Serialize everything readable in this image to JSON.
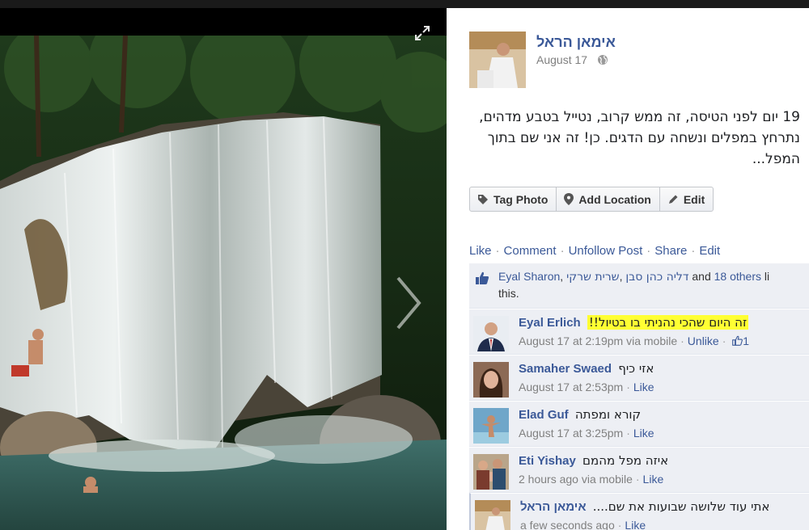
{
  "post": {
    "author": "אימאן הראל",
    "date": "August 17",
    "caption": "19 יום לפני הטיסה, זה ממש קרוב, נטייל בטבע מדהים, נתרחץ במפלים ונשחה עם הדגים. כן! זה אני שם בתוך המפל...",
    "actions": {
      "tag_photo": "Tag Photo",
      "add_location": "Add Location",
      "edit": "Edit"
    },
    "links": {
      "like": "Like",
      "comment": "Comment",
      "unfollow": "Unfollow Post",
      "share": "Share",
      "edit": "Edit"
    }
  },
  "likes": {
    "name1": "Eyal Sharon",
    "name2": "שרית שרקי",
    "name3": "דליה כהן סבן",
    "and": "and",
    "others": "18 others",
    "suffix": "li",
    "end": "this."
  },
  "comments": [
    {
      "name": "Eyal Erlich",
      "text": "זה היום שהכי נהניתי בו בטיול!!",
      "time": "August 17 at 2:19pm via mobile",
      "action": "Unlike",
      "like_count": "1"
    },
    {
      "name": "Samaher Swaed",
      "text": "אזי כיף",
      "time": "August 17 at 2:53pm",
      "action": "Like"
    },
    {
      "name": "Elad Guf",
      "text": "קורא ומפתה",
      "time": "August 17 at 3:25pm",
      "action": "Like"
    },
    {
      "name": "Eti Yishay",
      "text": "איזה מפל מהמם",
      "time": "2 hours ago via mobile",
      "action": "Like"
    },
    {
      "name": "אימאן הראל",
      "text": "אתי עוד שלושה שבועות את שם....",
      "time": "a few seconds ago",
      "action": "Like"
    }
  ],
  "colors": {
    "link": "#3b5998",
    "ufi_bg": "#edeff4",
    "highlight": "#ffff33"
  },
  "icons": [
    "expand-icon",
    "next-arrow-icon",
    "globe-icon",
    "tag-icon",
    "location-pin-icon",
    "pencil-icon",
    "thumbs-up-icon"
  ]
}
